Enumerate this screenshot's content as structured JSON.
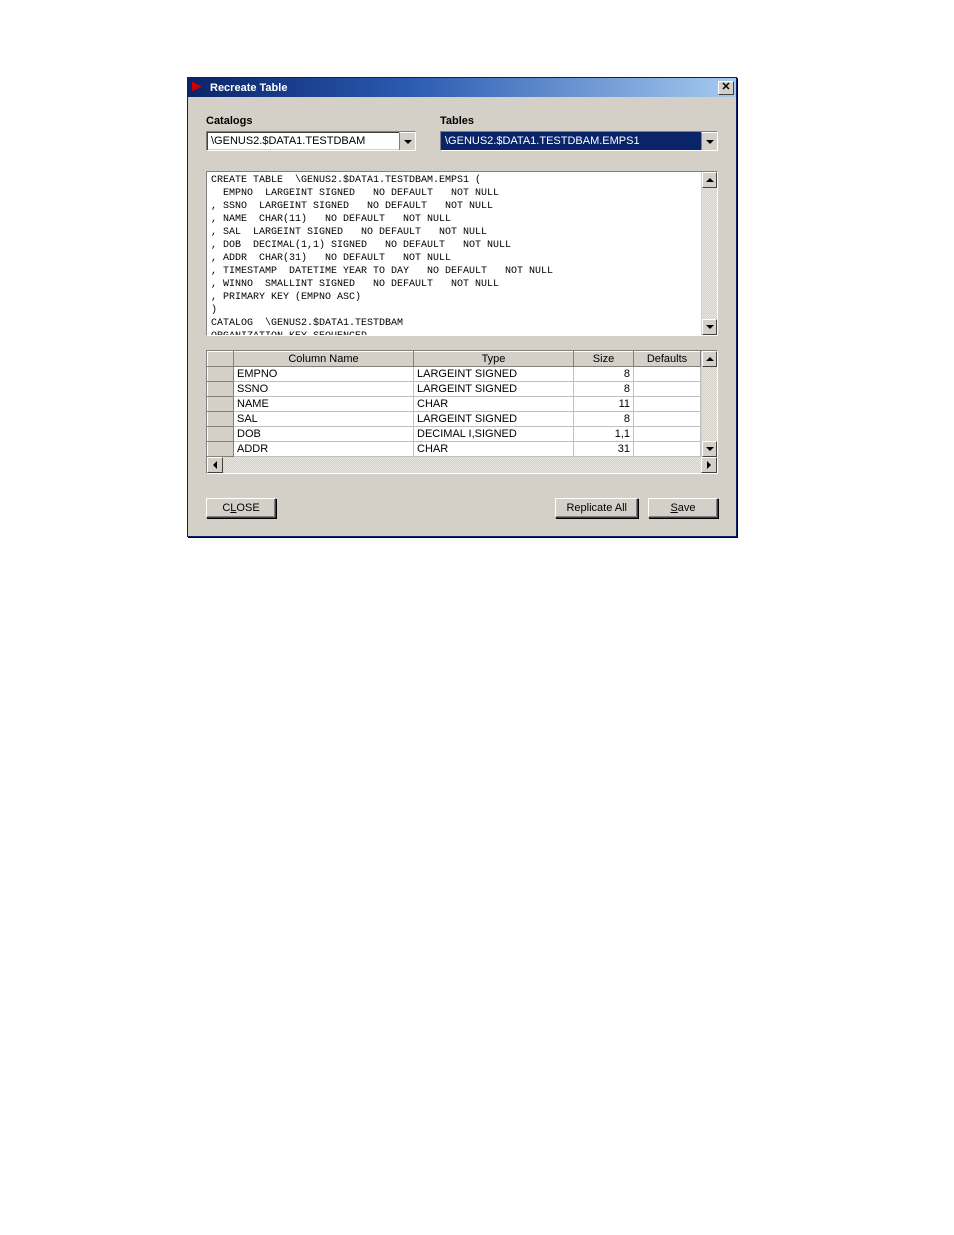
{
  "window": {
    "title": "Recreate Table"
  },
  "labels": {
    "catalogs": "Catalogs",
    "tables": "Tables"
  },
  "catalogs_value": "\\GENUS2.$DATA1.TESTDBAM",
  "tables_value": "\\GENUS2.$DATA1.TESTDBAM.EMPS1",
  "sql": "CREATE TABLE  \\GENUS2.$DATA1.TESTDBAM.EMPS1 (\n  EMPNO  LARGEINT SIGNED   NO DEFAULT   NOT NULL\n, SSNO  LARGEINT SIGNED   NO DEFAULT   NOT NULL\n, NAME  CHAR(11)   NO DEFAULT   NOT NULL\n, SAL  LARGEINT SIGNED   NO DEFAULT   NOT NULL\n, DOB  DECIMAL(1,1) SIGNED   NO DEFAULT   NOT NULL\n, ADDR  CHAR(31)   NO DEFAULT   NOT NULL\n, TIMESTAMP  DATETIME YEAR TO DAY   NO DEFAULT   NOT NULL\n, WINNO  SMALLINT SIGNED   NO DEFAULT   NOT NULL\n, PRIMARY KEY (EMPNO ASC)\n)\nCATALOG  \\GENUS2.$DATA1.TESTDBAM\nORGANIZATION KEY SEQUENCED\nPARTITION (",
  "grid": {
    "headers": {
      "col1": "Column Name",
      "col2": "Type",
      "col3": "Size",
      "col4": "Defaults"
    },
    "rows": [
      {
        "name": "EMPNO",
        "type": "LARGEINT SIGNED",
        "size": "8"
      },
      {
        "name": "SSNO",
        "type": "LARGEINT SIGNED",
        "size": "8"
      },
      {
        "name": "NAME",
        "type": "CHAR",
        "size": "11"
      },
      {
        "name": "SAL",
        "type": "LARGEINT SIGNED",
        "size": "8"
      },
      {
        "name": "DOB",
        "type": "DECIMAL I,SIGNED",
        "size": "1,1"
      },
      {
        "name": "ADDR",
        "type": "CHAR",
        "size": "31"
      }
    ]
  },
  "buttons": {
    "close_pre": "C",
    "close_ul": "L",
    "close_post": "OSE",
    "replicate": "Replicate All",
    "save_ul": "S",
    "save_post": "ave"
  }
}
